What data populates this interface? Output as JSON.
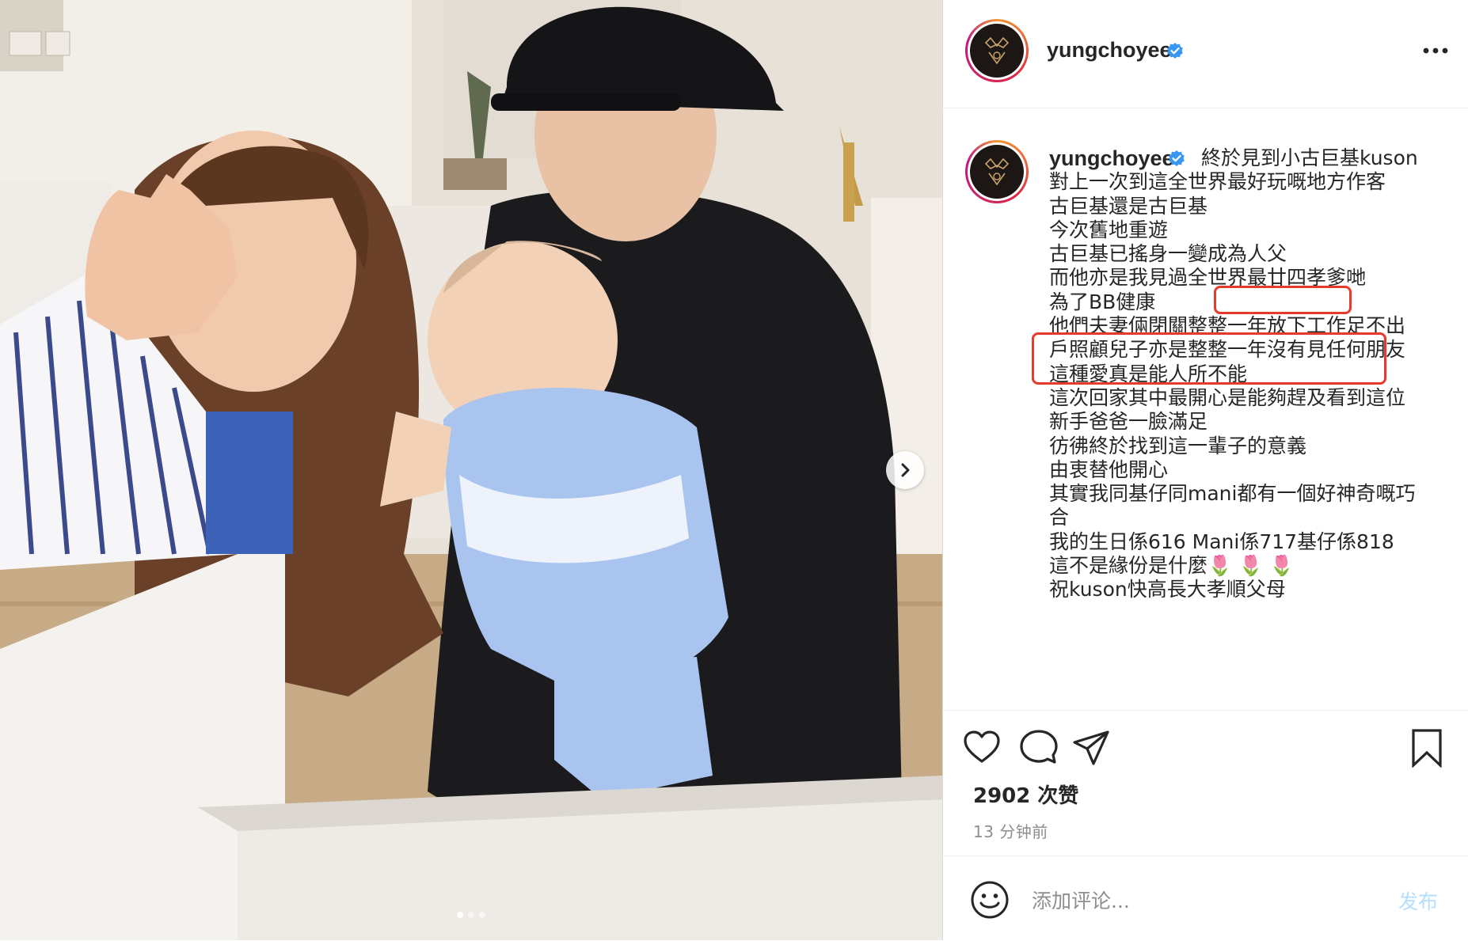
{
  "post": {
    "username": "yungchoyee",
    "verified": true,
    "caption_lines": [
      "終於見到小古巨基kuson",
      "對上一次到這全世界最好玩嘅地方作客",
      "古巨基還是古巨基",
      "今次舊地重遊",
      "古巨基已搖身一變成為人父",
      "而他亦是我見過全世界最廿四孝爹哋",
      "為了BB健康",
      "他們夫妻倆閉關整整一年放下工作足不出",
      "戶照顧兒子亦是整整一年沒有見任何朋友",
      "這種愛真是能人所不能",
      "這次回家其中最開心是能夠趕及看到這位",
      "新手爸爸一臉滿足",
      "彷彿終於找到這一輩子的意義",
      "由衷替他開心",
      "其實我同基仔同mani都有一個好神奇嘅巧",
      "合",
      "我的生日係616 Mani係717基仔係818",
      "這不是緣份是什麼🌷 🌷 🌷",
      "祝kuson快高長大孝順父母"
    ],
    "likes": "2902 次赞",
    "timestamp": "13 分钟前"
  },
  "comment": {
    "placeholder": "添加评论...",
    "post_label": "发布"
  },
  "carousel": {
    "slide_count": 3,
    "active_slide": 1
  },
  "icons": {
    "header_more": "more-dots-icon",
    "like": "heart-icon",
    "comment": "comment-bubble-icon",
    "share": "paper-plane-icon",
    "save": "bookmark-icon",
    "emoji": "smiley-icon",
    "next": "chevron-right-icon",
    "verified": "verified-badge-icon"
  },
  "colors": {
    "verified_blue": "#3897f0",
    "highlight_red": "#e63a2b",
    "post_button_disabled": "#b2dffc",
    "muted_text": "#8e8e8e"
  }
}
